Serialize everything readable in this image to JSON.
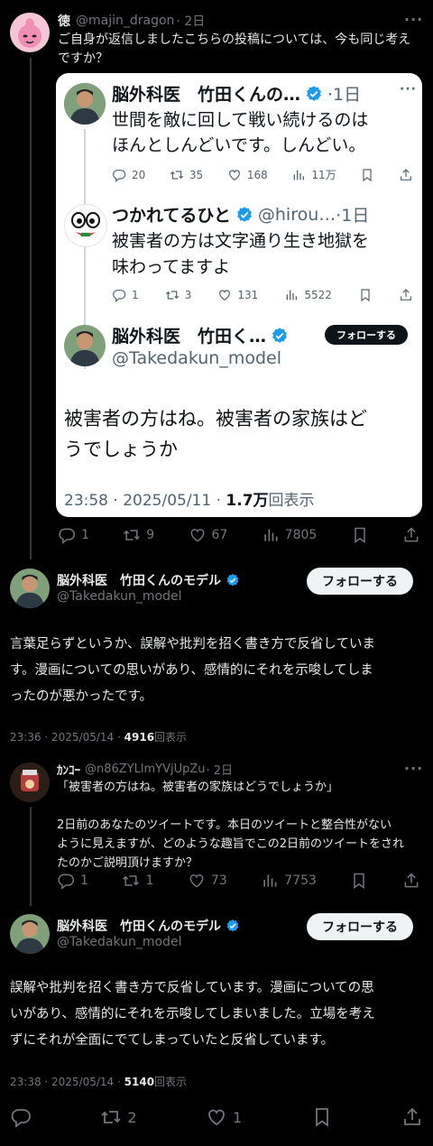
{
  "reply1": {
    "name": "徳",
    "handle": "@majin_dragon",
    "time": "· 2日",
    "text": "ご自身が返信しましたこちらの投稿については、今も同じ考え\nですか？",
    "more": "···",
    "replies": "1",
    "retweets": "9",
    "likes": "67",
    "views": "7805"
  },
  "quoted": {
    "t1": {
      "name": "脳外科医　竹田くんの…",
      "time": "·1日",
      "text": "世間を敵に回して戦い続けるのは\nほんとしんどいです。しんどい。",
      "more": "···",
      "replies": "20",
      "retweets": "35",
      "likes": "168",
      "views": "11万"
    },
    "t2": {
      "name": "つかれてるひと",
      "handle": "@hirou…",
      "time": "·1日",
      "text": "被害者の方は文字通り生き地獄を\n味わってますよ",
      "more": "···",
      "replies": "1",
      "retweets": "3",
      "likes": "131",
      "views": "5522"
    },
    "t3": {
      "name": "脳外科医　竹田く…",
      "handle": "@Takedakun_model",
      "follow": "フォローする",
      "text": "被害者の方はね。被害者の家族はど\nうでしょうか",
      "datetime": "23:58 · 2025/05/11 · ",
      "views_count": "1.7万",
      "views_label": "回表示"
    }
  },
  "main1": {
    "name": "脳外科医　竹田くんのモデル",
    "handle": "@Takedakun_model",
    "follow": "フォローする",
    "text": "言葉足らずというか、誤解や批判を招く書き方で反省していま\nす。漫画についての思いがあり、感情的にそれを示唆してしま\nったのが悪かったです。",
    "datetime": "23:36 · 2025/05/14 · ",
    "views_count": "4916",
    "views_label": "回表示"
  },
  "reply2": {
    "name": "ｶﾝｺｰ",
    "handle": "@n86ZYLlmYVjUpZu",
    "time": "· 2日",
    "more": "···",
    "text": "「被害者の方はね。被害者の家族はどうでしょうか」\n\n2日前のあなたのツイートです。本日のツイートと整合性がない\nように見えますが、どのような趣旨でこの2日前のツイートをされ\nたのかご説明頂けますか？",
    "replies": "1",
    "retweets": "1",
    "likes": "73",
    "views": "7753"
  },
  "main2": {
    "name": "脳外科医　竹田くんのモデル",
    "handle": "@Takedakun_model",
    "follow": "フォローする",
    "text": "誤解や批判を招く書き方で反省しています。漫画についての思\nいがあり、感情的にそれを示唆してしまいました。立場を考え\nずにそれが全面にでてしまっていたと反省しています。",
    "datetime": "23:38 · 2025/05/14 · ",
    "views_count": "5140",
    "views_label": "回表示",
    "retweets": "2",
    "likes": "1"
  },
  "colors": {
    "accent": "#1d9bf0",
    "background": "#000000",
    "muted": "#71767b"
  }
}
